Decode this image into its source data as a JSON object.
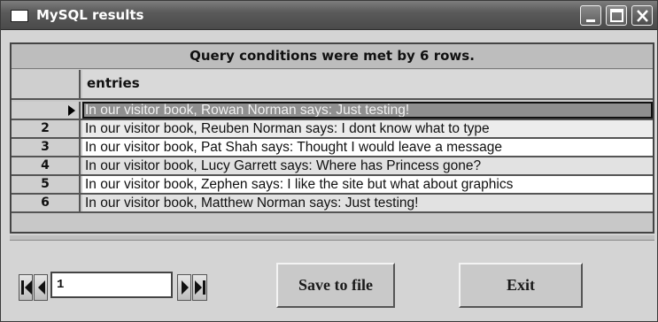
{
  "window": {
    "title": "MySQL results",
    "controls": [
      "minimize-icon",
      "maximize-icon",
      "close-icon"
    ]
  },
  "grid": {
    "status": "Query conditions were met by 6 rows.",
    "column_header": "entries",
    "rows": [
      {
        "num": "",
        "current": true,
        "text": "In our visitor book, Rowan Norman says: Just testing!"
      },
      {
        "num": "2",
        "text": "In our visitor book, Reuben Norman says: I dont know what to type"
      },
      {
        "num": "3",
        "text": "In our visitor book, Pat Shah says: Thought I would leave a message"
      },
      {
        "num": "4",
        "text": "In our visitor book, Lucy Garrett says: Where has Princess gone?"
      },
      {
        "num": "5",
        "text": "In our visitor book, Zephen  says: I like the site but what about graphics"
      },
      {
        "num": "6",
        "text": "In our visitor book, Matthew Norman says: Just testing!"
      }
    ]
  },
  "navigator": {
    "record_value": "1",
    "icons": [
      "first-record-icon",
      "previous-record-icon",
      "next-record-icon",
      "last-record-icon"
    ]
  },
  "buttons": {
    "save_label": "Save to file",
    "exit_label": "Exit"
  }
}
